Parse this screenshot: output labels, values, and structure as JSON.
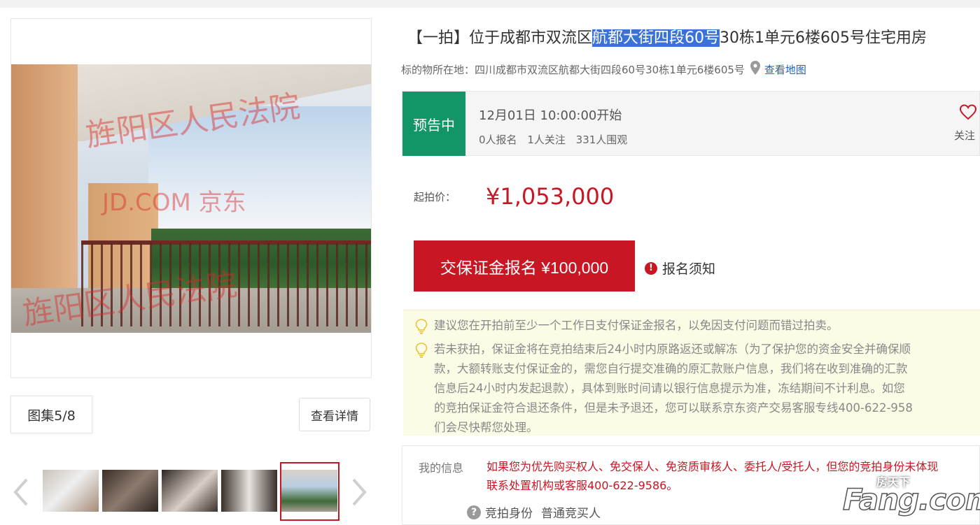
{
  "title": {
    "prefix": "【一拍】位于成都市双流区",
    "highlight": "航都大街四段60号",
    "suffix": "30栋1单元6楼605号住宅用房"
  },
  "location": {
    "label": "标的物所在地：",
    "address": "四川成都市双流区航都大街四段60号30栋1单元6楼605号",
    "map_link": "查看地图"
  },
  "gallery": {
    "watermarks": [
      "旌阳区人民法院",
      "JD.COM 京东",
      "旌阳区人民法院"
    ],
    "album_count": "图集5/8",
    "view_detail": "查看详情",
    "prev_icon": "chevron-left-icon",
    "next_icon": "chevron-right-icon",
    "selected_thumb": 5
  },
  "status": {
    "badge": "预告中",
    "start_time": "12月01日 10:00:00开始",
    "signups": "0人报名",
    "follows": "1人关注",
    "views": "331人围观",
    "follow_label": "关注"
  },
  "price": {
    "label": "起拍价：",
    "value": "¥1,053,000"
  },
  "signup": {
    "button": "交保证金报名 ¥100,000",
    "notice": "报名须知"
  },
  "tips": {
    "tip1": "建议您在开拍前至少一个工作日支付保证金报名，以免因支付问题而错过拍卖。",
    "tip2_lines": [
      "若未获拍，保证金将在竞拍结束后24小时内原路返还或解冻（为了保护您的资金安全并确保顺",
      "款，大额转账支付保证金的，需您自行提交准确的原汇款账户信息，我们将在收到准确的汇款",
      "信息后24小时内发起退款），具体到账时间请以银行信息提示为准，冻结期间不计利息。如您",
      "的竞拍保证金符合退还条件，但是未予退还，您可以联系京东资产交易客服专线400-622-958",
      "们会尽快帮您处理。"
    ]
  },
  "my_info": {
    "label": "我的信息",
    "warning_lines": [
      "如果您为优先购买权人、免交保人、免资质审核人、委托人/受托人，但您的竞拍身份未体现",
      "联系处置机构或客服400-622-9586。"
    ],
    "identity_label": "竞拍身份",
    "identity_value": "普通竞买人"
  },
  "logo": {
    "small": "房天下",
    "big": "Fang.com"
  },
  "colors": {
    "accent_red": "#c81623",
    "status_green": "#139667",
    "link_blue": "#1f62b8",
    "tip_bg": "#fcfce6"
  }
}
